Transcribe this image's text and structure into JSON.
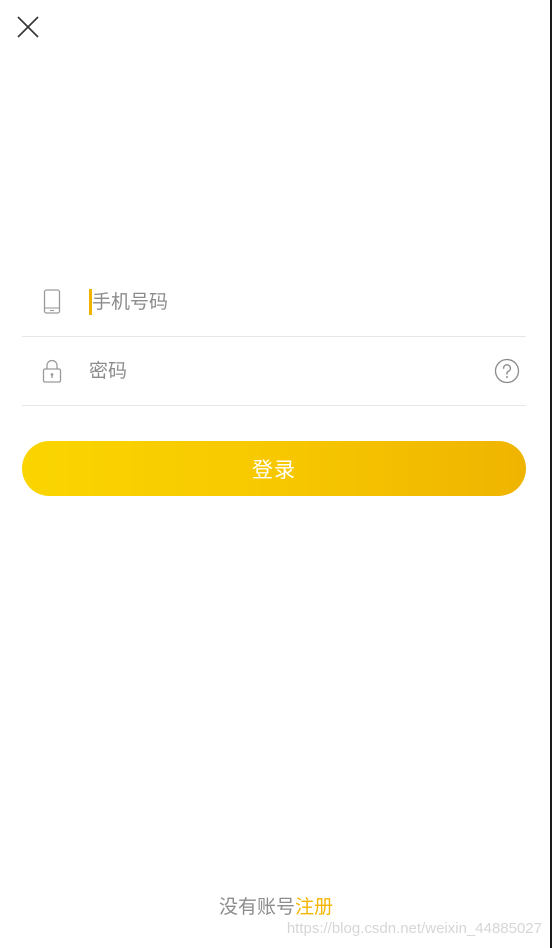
{
  "form": {
    "phone": {
      "placeholder": "手机号码",
      "value": "",
      "icon": "phone-icon"
    },
    "password": {
      "placeholder": "密码",
      "value": "",
      "icon": "lock-icon",
      "help_icon": "question-circle-icon"
    }
  },
  "actions": {
    "close_icon": "close-icon",
    "login_label": "登录"
  },
  "footer": {
    "prompt": "没有账号",
    "register_link": "注册"
  },
  "watermark": {
    "text": "https://blog.csdn.net/weixin_44885027"
  },
  "colors": {
    "accent": "#f3b600",
    "button_gradient_start": "#fbd500",
    "button_gradient_end": "#efb400",
    "placeholder": "#8c8c8c",
    "divider": "#e6e6e6"
  }
}
